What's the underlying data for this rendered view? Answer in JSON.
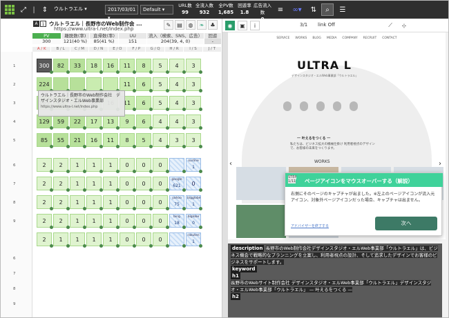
{
  "toolbar": {
    "site_select": "ウルトラエル",
    "date_select": "2017/03/01",
    "mode_select": "Default",
    "stats": [
      {
        "label": "URL数",
        "value": "99"
      },
      {
        "label": "全流入数",
        "value": "932"
      },
      {
        "label": "全PV数",
        "value": "1,685"
      },
      {
        "label": "回遊率",
        "value": "1.8"
      },
      {
        "label": "広告流入数",
        "value": "0"
      }
    ]
  },
  "page": {
    "index": "A",
    "number": "1",
    "title": "ウルトラエル｜長野市のWeb制作会 ...",
    "url": "https://www.ultra-l.net/index.php",
    "metrics_headers": [
      "PV",
      "離脱数(率)",
      "直帰数(率)",
      "UU",
      "流入（検索、SNS、広告）",
      "回遊"
    ],
    "metrics_values": [
      "300",
      "121(40 %)",
      "85(41 %)",
      "151",
      "204(39, 4, 0)",
      "-"
    ],
    "column_headers": [
      "A / K",
      "B / L",
      "C / M",
      "D / N",
      "E / O",
      "F / P",
      "G / Q",
      "H / R",
      "I / S",
      "J / T"
    ]
  },
  "grid_top": [
    [
      "300",
      "82",
      "33",
      "18",
      "16",
      "11",
      "8",
      "5",
      "4",
      "3"
    ],
    [
      "224",
      "",
      "",
      "",
      "",
      "11",
      "6",
      "5",
      "4",
      "3"
    ],
    [
      "165",
      "63",
      "27",
      "16",
      "16",
      "11",
      "6",
      "5",
      "4",
      "3"
    ],
    [
      "129",
      "59",
      "22",
      "17",
      "13",
      "9",
      "6",
      "4",
      "4",
      "3"
    ],
    [
      "85",
      "55",
      "21",
      "16",
      "11",
      "8",
      "5",
      "4",
      "3",
      "3"
    ]
  ],
  "grid_bottom": [
    [
      "2",
      "2",
      "1",
      "1",
      "1",
      "0",
      "0",
      "0",
      "",
      "ourline 1"
    ],
    [
      "2",
      "2",
      "1",
      "1",
      "1",
      "0",
      "0",
      "0",
      "google 621",
      "0"
    ],
    [
      "2",
      "2",
      "1",
      "1",
      "1",
      "0",
      "0",
      "0",
      "yahoo 75",
      "bigglobe 1"
    ],
    [
      "2",
      "2",
      "1",
      "1",
      "1",
      "0",
      "0",
      "0",
      "bing 18",
      "biglobe 0"
    ],
    [
      "2",
      "1",
      "1",
      "1",
      "1",
      "0",
      "0",
      "0",
      "",
      "rakuten 1"
    ]
  ],
  "row_numbers": [
    "1",
    "2",
    "3",
    "4",
    "5",
    "6",
    "7",
    "8",
    "9"
  ],
  "tooltip": {
    "title": "ウルトラエル｜長野市のWeb制作会社　デザインスタジオ・エルWeb事業部",
    "url": "https://www.ultra-l.net/index.php"
  },
  "right": {
    "pager": "3/1",
    "link_filter": "link Off",
    "nav": [
      "SERVICE",
      "WORKS",
      "BLOG",
      "MEDIA",
      "COMPANY",
      "RECRUIT",
      "CONTACT"
    ],
    "logo_text": "ULTRA L",
    "logo_sub": "デザインスタジオ・エルWeb事業部「ウルトラエル」",
    "slogan": "一 叶えるをつくる 一",
    "slogan_body": "私たちは、ビジネス拡大の機械仕掛け 利用者視点のデザインで、お客様の未来をつくります。",
    "works": "WORKS",
    "modal": {
      "step": "STEP",
      "step_num": "1/11",
      "title": "ページアイコンをマウスオーバーする（解説）",
      "body": "右側にそのページのキャプチャが出ました。※左上のページアイコンが流入元アイコン、対象外ページアイコンだった場合、キャプチャは出ません。",
      "link": "アドバイザーを終了する",
      "next": "次へ"
    },
    "seo": {
      "description_tag": "description",
      "description": "長野市のWeb制作会社デザインスタジオ・エルWeb事業部「ウルトラエル」は、ビジネス機会で戦略的なプランニングを立案し、利用者視点の設計、そして追求したデザインでお客様のビジネスをサポートします。",
      "keyword_tag": "keyword",
      "h1_tag": "h1",
      "h1": "長野市のWebサイト制作会社 デザインスタジオ・エルWeb事業部「ウルトラエル」デザインスタジオ・エルWeb事業部「ウルトラエル」 — 叶えるをつくる —",
      "h2_tag": "h2"
    }
  },
  "colors": {
    "toolbar_bg": "#2f2f2f",
    "accent_green": "#3fd29a",
    "pv_green": "#4caf50",
    "next_button": "#3d7a66"
  }
}
